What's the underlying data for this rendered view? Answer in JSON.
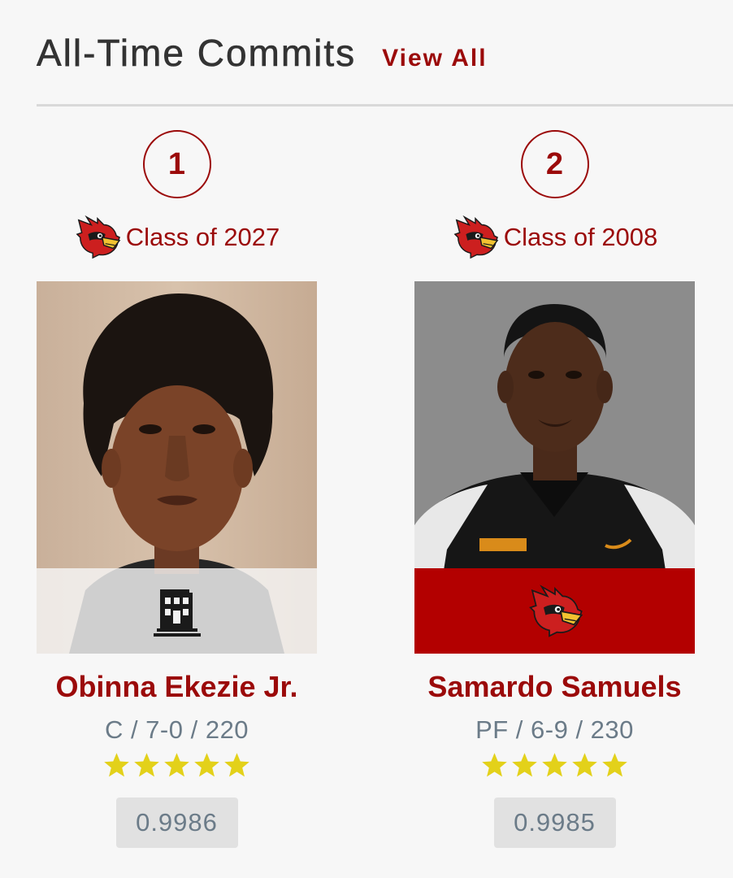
{
  "header": {
    "title": "All-Time Commits",
    "view_all_label": "View All"
  },
  "colors": {
    "accent": "#9b0a0a",
    "band_red": "#b30000",
    "star": "#e3d11a",
    "muted_text": "#6b7b88"
  },
  "commits": [
    {
      "rank": "1",
      "class_label": "Class of 2027",
      "team_icon": "cardinal-logo-icon",
      "band_icon": "school-building-icon",
      "name": "Obinna Ekezie Jr.",
      "measurements": "C / 7-0 / 220",
      "stars": 5,
      "rating": "0.9986"
    },
    {
      "rank": "2",
      "class_label": "Class of 2008",
      "team_icon": "cardinal-logo-icon",
      "band_icon": "cardinal-logo-icon",
      "name": "Samardo Samuels",
      "measurements": "PF / 6-9 / 230",
      "stars": 5,
      "rating": "0.9985"
    }
  ]
}
